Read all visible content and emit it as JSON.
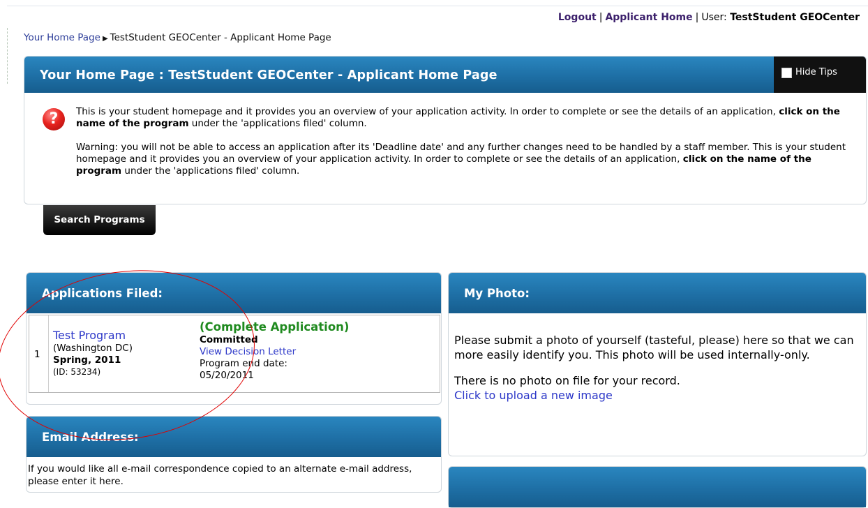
{
  "topnav": {
    "logout": "Logout",
    "sep1": "|",
    "applicant_home": "Applicant Home",
    "sep2": "|",
    "user_label": "User:",
    "user_name": "TestStudent GEOCenter"
  },
  "breadcrumb": {
    "home": "Your Home Page",
    "current": "TestStudent GEOCenter - Applicant Home Page"
  },
  "title": {
    "text": "Your Home Page : TestStudent GEOCenter - Applicant Home Page",
    "hide_tips": "Hide Tips"
  },
  "tips": {
    "p1_a": "This is your student homepage and it provides you an overview of your application activity. In order to complete or see the details of an application, ",
    "p1_bold": "click on the name of the program",
    "p1_b": " under the 'applications filed' column.",
    "p2_a": "Warning: you will not be able to access an application after its 'Deadline date' and any further changes need to be handled by a staff member. This is your student homepage and it provides you an overview of your application activity. In order to complete or see the details of an application, ",
    "p2_bold": "click on the name of the program",
    "p2_b": " under the 'applications filed' column."
  },
  "search_button": "Search Programs",
  "applications": {
    "header": "Applications Filed:",
    "rows": [
      {
        "num": "1",
        "program": "Test Program",
        "location": "(Washington DC)",
        "term": "Spring, 2011",
        "id": "(ID: 53234)",
        "status": "(Complete Application)",
        "decision": "Committed",
        "letter_link": "View Decision Letter",
        "end_label": "Program end date:",
        "end_date": "05/20/2011"
      }
    ]
  },
  "email": {
    "header": "Email Address:",
    "text": "If you would like all e-mail correspondence copied to an alternate e-mail address, please enter it here."
  },
  "photo": {
    "header": "My Photo:",
    "text1": "Please submit a photo of yourself (tasteful, please) here so that we can more easily identify you. This photo will be used internally-only.",
    "text2": "There is no photo on file for your record.",
    "upload_link": "Click to upload a new image"
  },
  "colors": {
    "header_blue": "#1e6fa5",
    "link_blue": "#2c37c8",
    "status_green": "#1f8a1f",
    "annotation_red": "#e00000"
  },
  "icons": [
    "question-icon",
    "checkbox-icon",
    "breadcrumb-arrow-icon"
  ]
}
